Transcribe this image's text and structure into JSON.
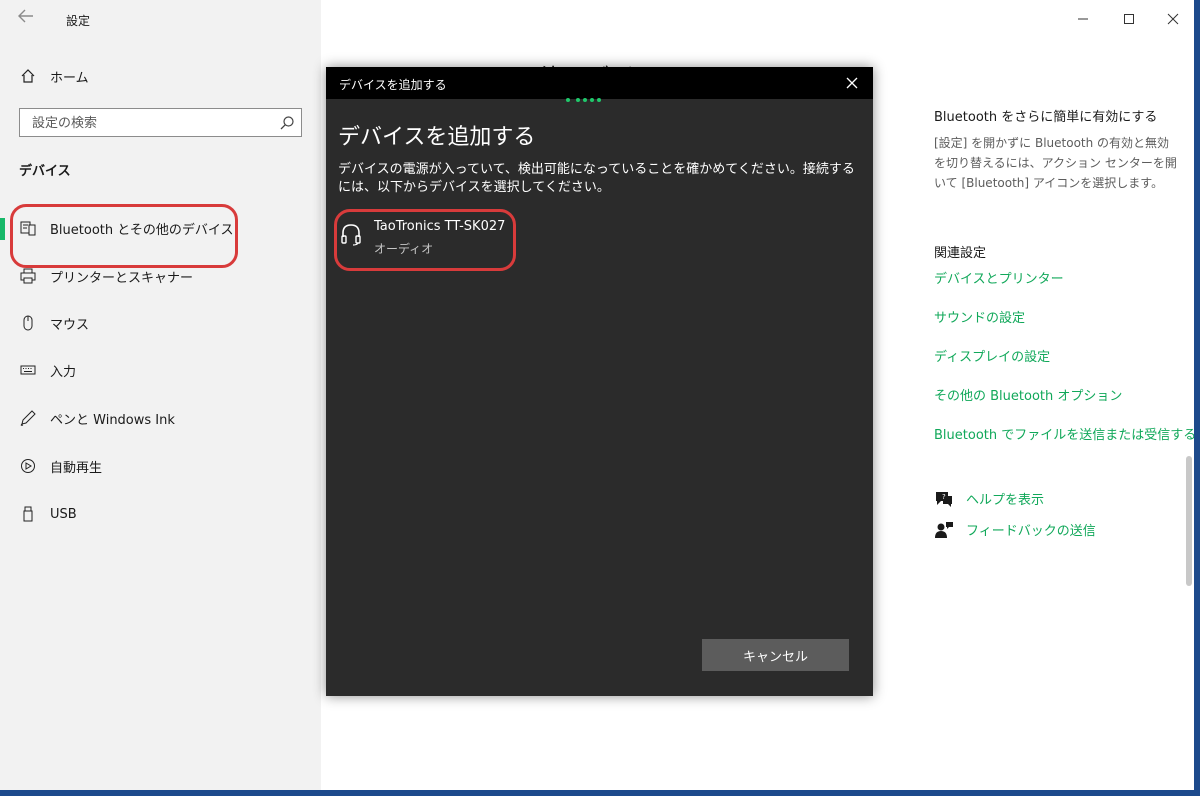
{
  "window": {
    "title": "設定",
    "back_glyph": "←",
    "controls": [
      "minimize",
      "maximize",
      "close"
    ]
  },
  "sidebar": {
    "home": {
      "label": "ホーム",
      "icon": "home-icon"
    },
    "search": {
      "placeholder": "設定の検索",
      "icon": "search-icon"
    },
    "section": "デバイス",
    "items": [
      {
        "label": "Bluetooth とその他のデバイス",
        "icon": "bluetooth-devices-icon",
        "active": true
      },
      {
        "label": "プリンターとスキャナー",
        "icon": "printer-icon"
      },
      {
        "label": "マウス",
        "icon": "mouse-icon"
      },
      {
        "label": "入力",
        "icon": "keyboard-icon"
      },
      {
        "label": "ペンと Windows Ink",
        "icon": "pen-icon"
      },
      {
        "label": "自動再生",
        "icon": "autoplay-icon"
      },
      {
        "label": "USB",
        "icon": "usb-icon"
      }
    ]
  },
  "main": {
    "heading": "Bluetooth とその他のデバイス"
  },
  "right_panel": {
    "tip_title": "Bluetooth をさらに簡単に有効にする",
    "tip_body": "[設定] を開かずに Bluetooth の有効と無効を切り替えるには、アクション センターを開いて [Bluetooth] アイコンを選択します。",
    "related_title": "関連設定",
    "links": [
      "デバイスとプリンター",
      "サウンドの設定",
      "ディスプレイの設定",
      "その他の Bluetooth オプション",
      "Bluetooth でファイルを送信または受信する"
    ],
    "help": [
      {
        "label": "ヘルプを表示",
        "icon": "help-chat-icon"
      },
      {
        "label": "フィードバックの送信",
        "icon": "feedback-icon"
      }
    ]
  },
  "dialog": {
    "titlebar": "デバイスを追加する",
    "heading": "デバイスを追加する",
    "description": "デバイスの電源が入っていて、検出可能になっていることを確かめてください。接続するには、以下からデバイスを選択してください。",
    "devices": [
      {
        "name": "TaoTronics TT-SK027",
        "type": "オーディオ",
        "icon": "headphones-icon"
      }
    ],
    "cancel_label": "キャンセル",
    "accent": "#1fc86b"
  },
  "colors": {
    "accent_green": "#11a85a",
    "annotation_red": "#d83b3b",
    "dialog_bg": "#2b2b2b"
  }
}
